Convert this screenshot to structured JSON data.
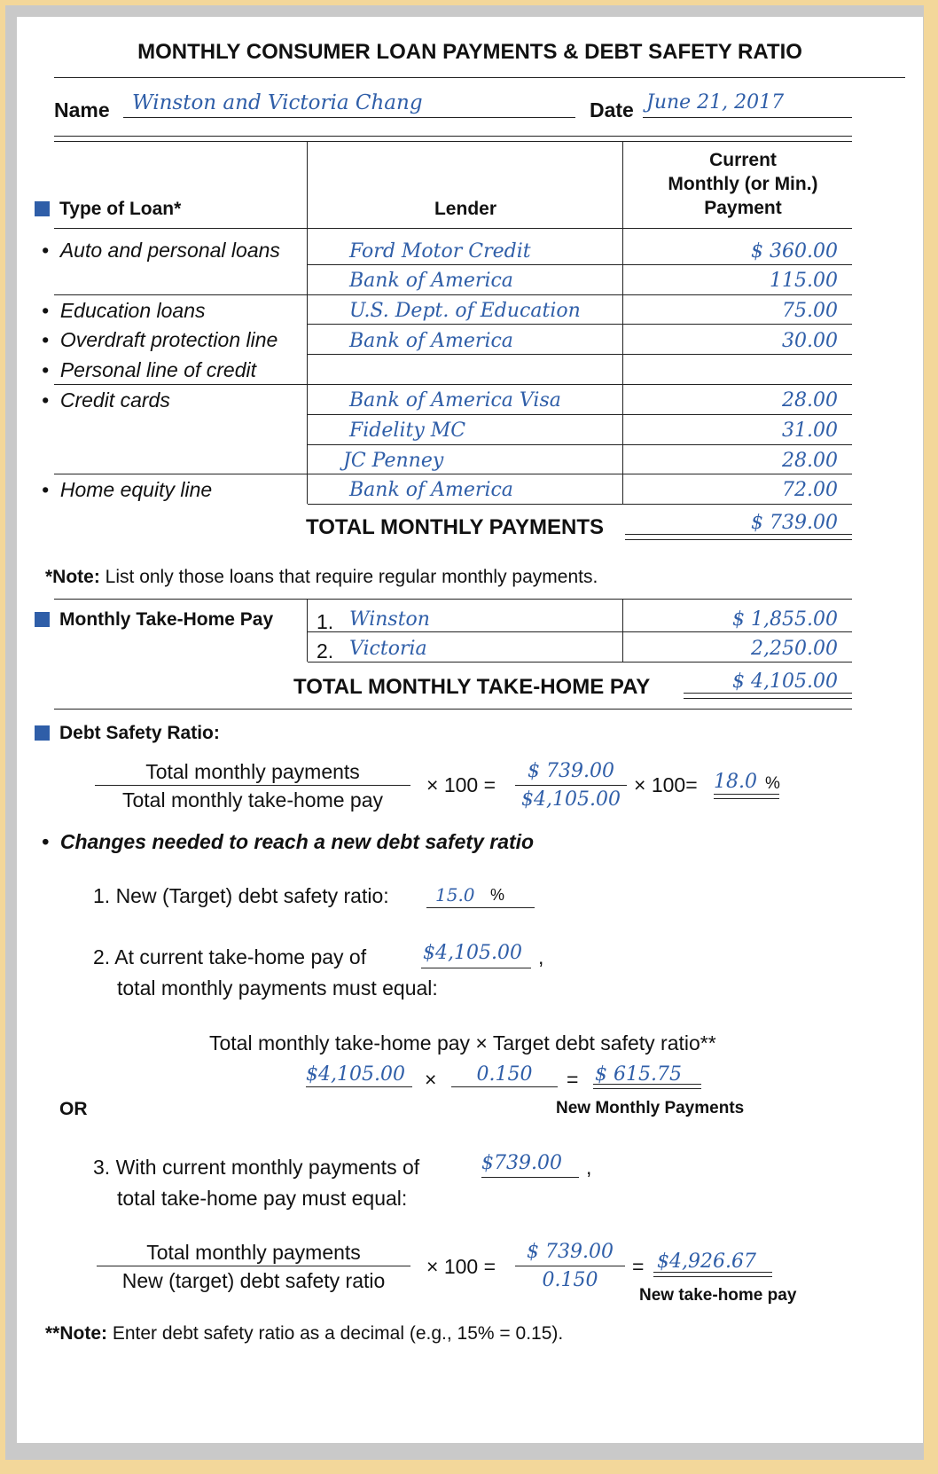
{
  "title": "MONTHLY CONSUMER LOAN PAYMENTS & DEBT SAFETY RATIO",
  "name_label": "Name",
  "name_value": "Winston and Victoria Chang",
  "date_label": "Date",
  "date_value": "June 21, 2017",
  "columns": {
    "type": "Type of Loan*",
    "lender": "Lender",
    "payment_line1": "Current",
    "payment_line2": "Monthly (or Min.)",
    "payment_line3": "Payment"
  },
  "loan_types": [
    "Auto and personal loans",
    "Education loans",
    "Overdraft protection line",
    "Personal line of credit",
    "Credit cards",
    "Home equity line"
  ],
  "loans": [
    {
      "lender": "Ford Motor Credit",
      "payment": "$ 360.00"
    },
    {
      "lender": "Bank of America",
      "payment": "115.00"
    },
    {
      "lender": "U.S. Dept. of Education",
      "payment": "75.00"
    },
    {
      "lender": "Bank of America",
      "payment": "30.00"
    },
    {
      "lender": "",
      "payment": ""
    },
    {
      "lender": "Bank of America Visa",
      "payment": "28.00"
    },
    {
      "lender": "Fidelity MC",
      "payment": "31.00"
    },
    {
      "lender": "JC Penney",
      "payment": "28.00"
    },
    {
      "lender": "Bank of America",
      "payment": "72.00"
    }
  ],
  "total_payments_label": "TOTAL MONTHLY PAYMENTS",
  "total_payments_value": "$ 739.00",
  "note1_bold": "*Note:",
  "note1_text": " List only those loans that require regular monthly payments.",
  "takehome": {
    "label": "Monthly Take-Home Pay",
    "rows": [
      {
        "num": "1.",
        "name": "Winston",
        "amount": "$ 1,855.00"
      },
      {
        "num": "2.",
        "name": "Victoria",
        "amount": "2,250.00"
      }
    ],
    "total_label": "TOTAL MONTHLY TAKE-HOME PAY",
    "total_value": "$ 4,105.00"
  },
  "dsr": {
    "label": "Debt Safety Ratio:",
    "numerator": "Total monthly payments",
    "denominator": "Total monthly take-home pay",
    "times100": "× 100 =",
    "num_value": "$ 739.00",
    "den_value": "$4,105.00",
    "times100b": "× 100=",
    "result": "18.0",
    "pct": "%"
  },
  "changes": {
    "heading": "Changes needed to reach a new debt safety ratio",
    "item1_text": "1. New (Target) debt safety ratio:",
    "item1_value": "15.0",
    "item1_pct": "%",
    "item2_line1": "2. At current take-home pay of",
    "item2_value": "$4,105.00",
    "item2_comma": ",",
    "item2_line2": "total monthly payments must equal:",
    "formula2": "Total monthly take-home pay × Target debt safety ratio**",
    "f2_a": "$4,105.00",
    "f2_times": "×",
    "f2_b": "0.150",
    "f2_eq": "=",
    "f2_result": "$ 615.75",
    "f2_result_label": "New Monthly Payments",
    "or": "OR",
    "item3_line1": "3. With current monthly payments of",
    "item3_value": "$739.00",
    "item3_comma": ",",
    "item3_line2": "total take-home pay must equal:",
    "f3_num": "Total monthly payments",
    "f3_den": "New (target) debt safety ratio",
    "f3_times": "× 100 =",
    "f3_num_value": "$ 739.00",
    "f3_den_value": "0.150",
    "f3_eq": "=",
    "f3_result": "$4,926.67",
    "f3_result_label": "New take-home pay"
  },
  "note2_bold": "**Note:",
  "note2_text": " Enter debt safety ratio as a decimal (e.g., 15% = 0.15)."
}
